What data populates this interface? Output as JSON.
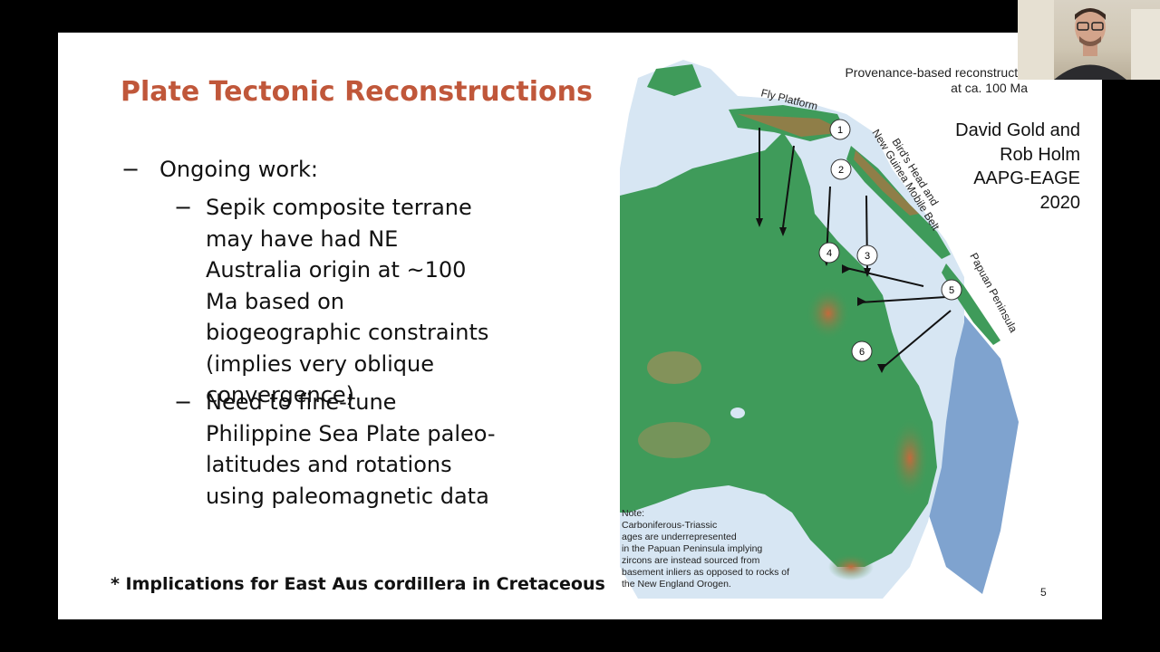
{
  "slide": {
    "title": "Plate Tectonic Reconstructions",
    "bullet_main_dash": "−",
    "bullet_main": "Ongoing work:",
    "sub_bullets": [
      {
        "dash": "−",
        "text": "Sepik composite terrane may have had NE Australia origin at ~100 Ma based on biogeographic constraints (implies very oblique convergence)"
      },
      {
        "dash": "−",
        "text": "Need to fine-tune Philippine Sea Plate paleo-latitudes and rotations using paleomagnetic data"
      }
    ],
    "footnote": "* Implications for East Aus cordillera in Cretaceous",
    "page_number": "5"
  },
  "figure": {
    "caption_line1": "Provenance-based reconstructio",
    "caption_line2": "at ca. 100 Ma",
    "credit_lines": [
      "David Gold and",
      "Rob Holm",
      "AAPG-EAGE",
      "2020"
    ],
    "labels": {
      "fly_platform": "Fly Platform",
      "birds_head_1": "Bird's Head and",
      "birds_head_2": "New Guinea Mobile Belt",
      "papuan": "Papuan Peninsula"
    },
    "markers": [
      "1",
      "2",
      "3",
      "4",
      "5",
      "6"
    ],
    "note_lines": [
      "Note:",
      "Carboniferous-Triassic",
      "ages are underrepresented",
      "in the Papuan Peninsula implying",
      "zircons are instead sourced from",
      "basement inliers as opposed to rocks of",
      "the New England Orogen."
    ],
    "colors": {
      "land": "#3f9b5a",
      "highland": "#c88a5a",
      "shelf": "#d7e6f3",
      "ocean": "#7fa3cf"
    }
  }
}
